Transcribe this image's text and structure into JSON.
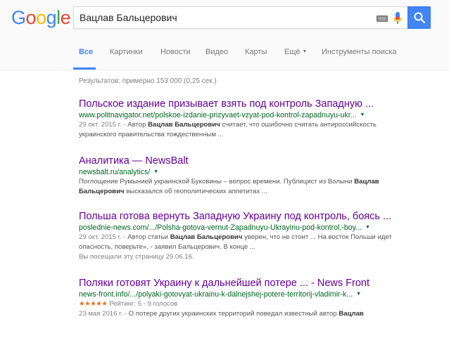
{
  "logo": "Google",
  "search": {
    "query": "Вацлав Бальцерович"
  },
  "tabs": [
    {
      "label": "Все"
    },
    {
      "label": "Картинки"
    },
    {
      "label": "Новости"
    },
    {
      "label": "Видео"
    },
    {
      "label": "Карты"
    },
    {
      "label": "Ещё"
    },
    {
      "label": "Инструменты поиска"
    }
  ],
  "stats": "Результатов: примерно 153 000 (0,25 сек.)",
  "results": [
    {
      "title": "Польское издание призывает взять под контроль Западную ...",
      "url": "www.politnavigator.net/polskoe-izdanie-prizyvaet-vzyat-pod-kontrol-zapadnuyu-ukr...",
      "date": "29 окт. 2015 г. -",
      "s1": " Автор ",
      "b1": "Вацлав Бальцерович",
      "s2": " считает, что ошибочно считать антироссийскость украинского правительства тождественным ..."
    },
    {
      "title": "Аналитика — NewsBalt",
      "url": "newsbalt.ru/analytics/",
      "s1": "Поглощение Румынией украинской Буковины – вопрос времени. Публицист из Волыни ",
      "b1": "Вацлав Бальцерович",
      "s2": " высказался об геополитических аппетитах ..."
    },
    {
      "title": "Польша готова вернуть Западную Украину под контроль, боясь ...",
      "url": "poslednie-news.com/.../Polsha-gotova-vernut-Zapadnuyu-Ukrayinu-pod-kontrol,-boy...",
      "date": "29 окт. 2015 г. -",
      "s1": " Автор статьи ",
      "b1": "Вацлав Бальцерович",
      "s2": " уверен, что не стоит ... На восток Польши идет опасность, поверьте», - заявил Бальцерович. В конце ...",
      "visited": "Вы посещали эту страницу 29.06.16."
    },
    {
      "title": "Поляки готовят Украину к дальнейшей потере ... - News Front",
      "url": "news-front.info/.../polyaki-gotovyat-ukrainu-k-dalnejshej-potere-territorij-vladimir-k...",
      "stars": "★★★★★",
      "rating": "Рейтинг: 5 - 9 голосов",
      "date": "23 мая 2016 г. -",
      "s1": " О потере других украинских территорий поведал известный автор ",
      "b1": "Вацлав"
    }
  ],
  "colors": {
    "accent": "#4285f4",
    "title_visited": "#660099",
    "url": "#006621",
    "stars": "#e7711b"
  },
  "icons": [
    "keyboard-icon",
    "microphone-icon",
    "search-icon",
    "dropdown-arrow-icon",
    "star-icon"
  ]
}
